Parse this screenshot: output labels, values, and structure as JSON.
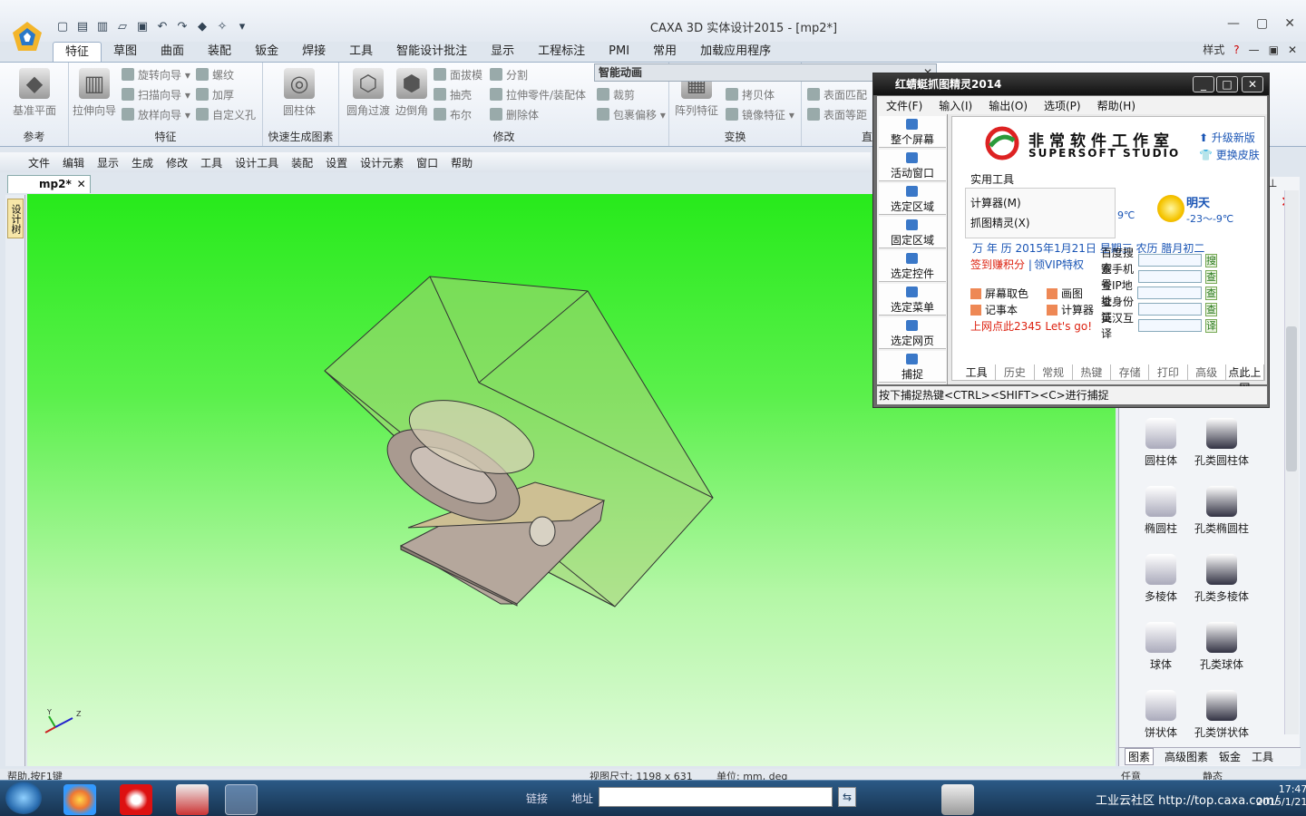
{
  "app": {
    "title": "CAXA 3D 实体设计2015 - [mp2*]",
    "ribbon_tabs": [
      "特征",
      "草图",
      "曲面",
      "装配",
      "钣金",
      "焊接",
      "工具",
      "智能设计批注",
      "显示",
      "工程标注",
      "PMI",
      "常用",
      "加载应用程序"
    ],
    "active_tab": "特征",
    "style_label": "样式",
    "ribbon_groups": {
      "reference": {
        "label": "参考",
        "big": "基准平面"
      },
      "feature": {
        "label": "特征",
        "big": "拉伸向导",
        "small": [
          "旋转向导",
          "扫描向导",
          "放样向导",
          "螺纹",
          "加厚",
          "自定义孔"
        ]
      },
      "quick": {
        "label": "快速生成图素",
        "big": "圆柱体"
      },
      "modify": {
        "label": "修改",
        "big1": "圆角过渡",
        "big2": "边倒角",
        "small": [
          "面拔模",
          "抽壳",
          "布尔",
          "分割",
          "拉伸零件/装配体",
          "删除体",
          "裁剪",
          "包裹偏移"
        ]
      },
      "transform": {
        "label": "变换",
        "big": "阵列特征",
        "small": [
          "拷贝体",
          "镜像特征"
        ]
      },
      "surface_match": {
        "label": "直",
        "small": [
          "表面匹配",
          "表面等距"
        ]
      }
    },
    "anim_panel": "智能动画",
    "menu": [
      "文件",
      "编辑",
      "显示",
      "生成",
      "修改",
      "工具",
      "设计工具",
      "装配",
      "设置",
      "设计元素",
      "窗口",
      "帮助"
    ],
    "doc_tab": "mp2*",
    "left_tab": "设计树",
    "status": {
      "left": "帮助,按F1键",
      "size": "视图尺寸: 1198 x 631",
      "units": "单位: mm, deg",
      "combo1": "任意",
      "combo2": "静态"
    },
    "axis": {
      "y": "Y",
      "z": "Z"
    }
  },
  "right_panel": {
    "items": [
      {
        "left": "圆柱体",
        "right": "孔类圆柱体"
      },
      {
        "left": "椭圆柱",
        "right": "孔类椭圆柱"
      },
      {
        "left": "多棱体",
        "right": "孔类多棱体"
      },
      {
        "left": "球体",
        "right": "孔类球体"
      },
      {
        "left": "饼状体",
        "right": "孔类饼状体"
      }
    ],
    "tabs": [
      "图素",
      "高级图素",
      "钣金",
      "工具"
    ]
  },
  "capture": {
    "title": "红蜻蜓抓图精灵2014",
    "menu": [
      "文件(F)",
      "输入(I)",
      "输出(O)",
      "选项(P)",
      "帮助(H)"
    ],
    "left_buttons": [
      "整个屏幕",
      "活动窗口",
      "选定区域",
      "固定区域",
      "选定控件",
      "选定菜单",
      "选定网页",
      "捕捉"
    ],
    "brand_cn": "非常软件工作室",
    "brand_en": "SUPERSOFT STUDIO",
    "upgrade": "升级新版",
    "skin": "更换皮肤",
    "tools_label": "实用工具",
    "tool1": "计算器(M)",
    "tool2": "抓图精灵(X)",
    "weather_temp": "9℃",
    "weather_day": "明天",
    "weather_range": "-23～-9℃",
    "calendar": "万 年 历 2015年1月21日 星期三 农历 腊月初二",
    "sign": "签到赚积分",
    "sep": "|",
    "vip": "领VIP特权",
    "quick": [
      "屏幕取色",
      "画图",
      "记事本",
      "计算器"
    ],
    "promo": "上网点此2345 Let's go!",
    "searches": [
      {
        "label": "百度搜索",
        "btn": "搜"
      },
      {
        "label": "查手机号",
        "btn": "查"
      },
      {
        "label": "查IP地址",
        "btn": "查"
      },
      {
        "label": "查身份证",
        "btn": "查"
      },
      {
        "label": "英汉互译",
        "btn": "译"
      }
    ],
    "bottom_tabs": [
      "工具",
      "历史",
      "常规",
      "热键",
      "存储",
      "打印",
      "高级",
      "点此上网"
    ],
    "status": "按下捕捉热键<CTRL><SHIFT><C>进行捕捉"
  },
  "taskbar": {
    "link": "链接",
    "address": "地址",
    "address_value": "",
    "tray_text": "工业云社区 http://top.caxa.com/",
    "time": "17:47",
    "date": "2015/1/21"
  }
}
